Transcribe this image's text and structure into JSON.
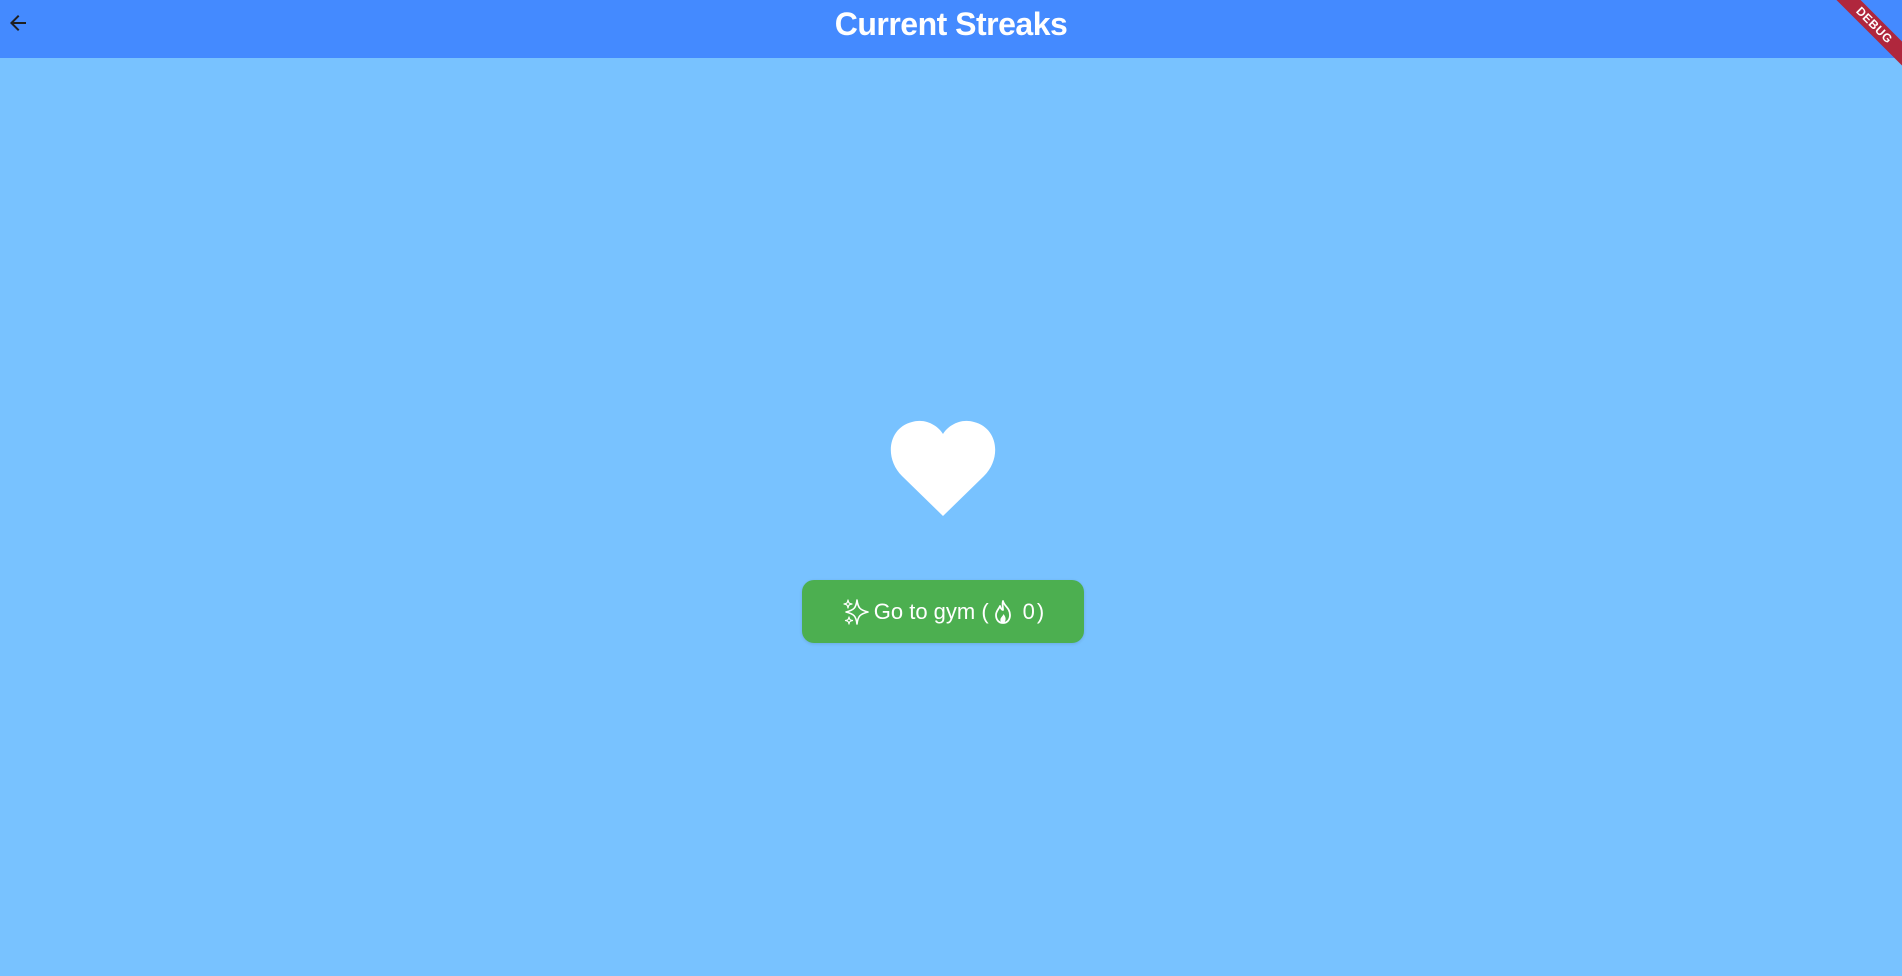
{
  "appbar": {
    "title": "Current Streaks",
    "back_icon": "arrow-back-icon",
    "color": "#448aff"
  },
  "debug_banner": {
    "label": "DEBUG",
    "color": "#b0273d"
  },
  "main": {
    "background": "#78c2ff",
    "heart_icon": "heart-icon",
    "streak_button": {
      "sparkle_icon": "sparkles-icon",
      "label_prefix": "Go to gym (",
      "fire_icon": "fire-icon",
      "count": "0",
      "label_suffix": ")",
      "color": "#4caf50"
    }
  }
}
